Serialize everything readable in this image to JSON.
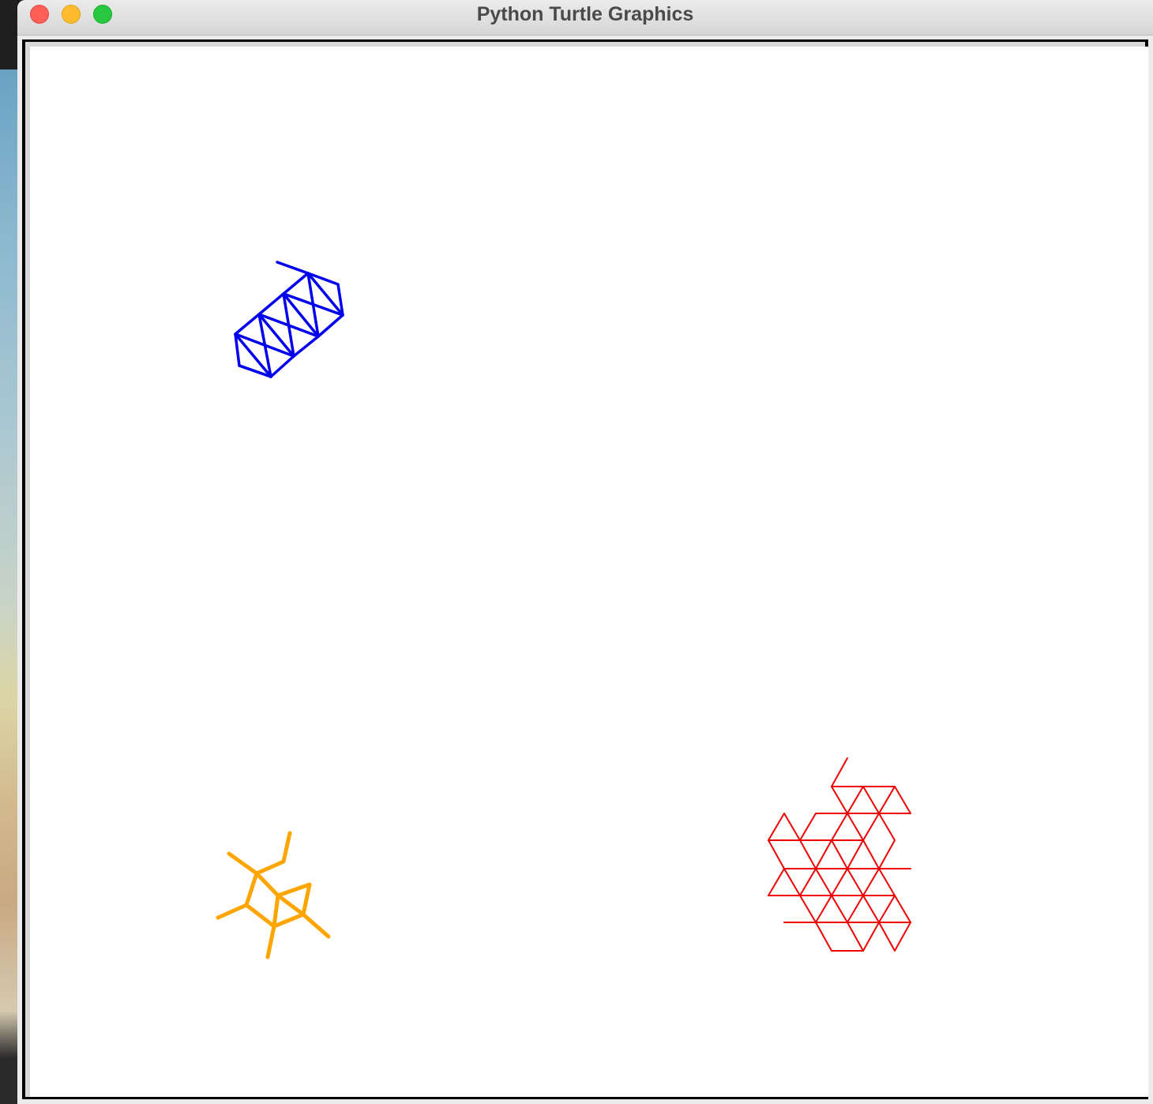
{
  "window": {
    "title": "Python Turtle Graphics",
    "controls": {
      "close": "close-icon",
      "minimize": "minimize-icon",
      "zoom": "zoom-icon"
    }
  },
  "canvas": {
    "background": "#ffffff",
    "drawings": [
      {
        "name": "blue-triangle-grid",
        "color": "#0000ee"
      },
      {
        "name": "orange-star-figure",
        "color": "#ffa500"
      },
      {
        "name": "red-triangle-mesh",
        "color": "#ee0000"
      }
    ]
  }
}
